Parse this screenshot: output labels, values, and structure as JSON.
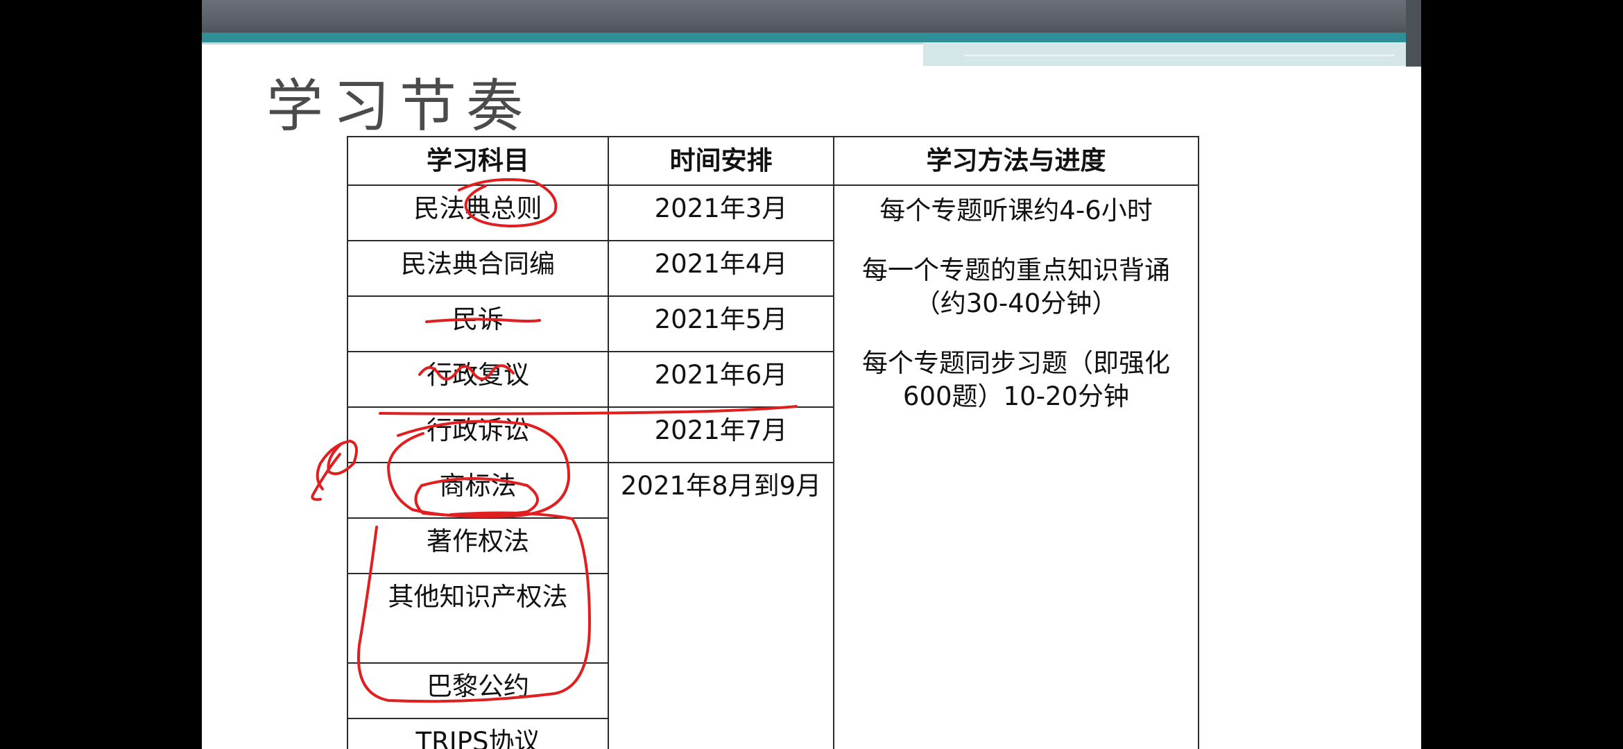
{
  "slide": {
    "title": "学习节奏",
    "table": {
      "headers": [
        "学习科目",
        "时间安排",
        "学习方法与进度"
      ],
      "subjects": [
        "民法典总则",
        "民法典合同编",
        "民诉",
        "行政复议",
        "行政诉讼",
        "商标法",
        "著作权法",
        "其他知识产权法",
        "巴黎公约",
        "TRIPS协议"
      ],
      "times": [
        "2021年3月",
        "2021年4月",
        "2021年5月",
        "2021年6月",
        "2021年7月",
        "2021年8月到9月"
      ],
      "methods": [
        [
          "每个专题听课约4-6小时"
        ],
        [
          "每一个专题的重点知识背诵",
          "（约30-40分钟）"
        ],
        [
          "每个专题同步习题（即强化",
          "600题）10-20分钟"
        ]
      ]
    }
  },
  "colors": {
    "ink": "#e02020",
    "teal_band": "#2e8f96",
    "dark_band": "#5b6069"
  },
  "webcam": {
    "icon": "presenter-video-icon"
  }
}
